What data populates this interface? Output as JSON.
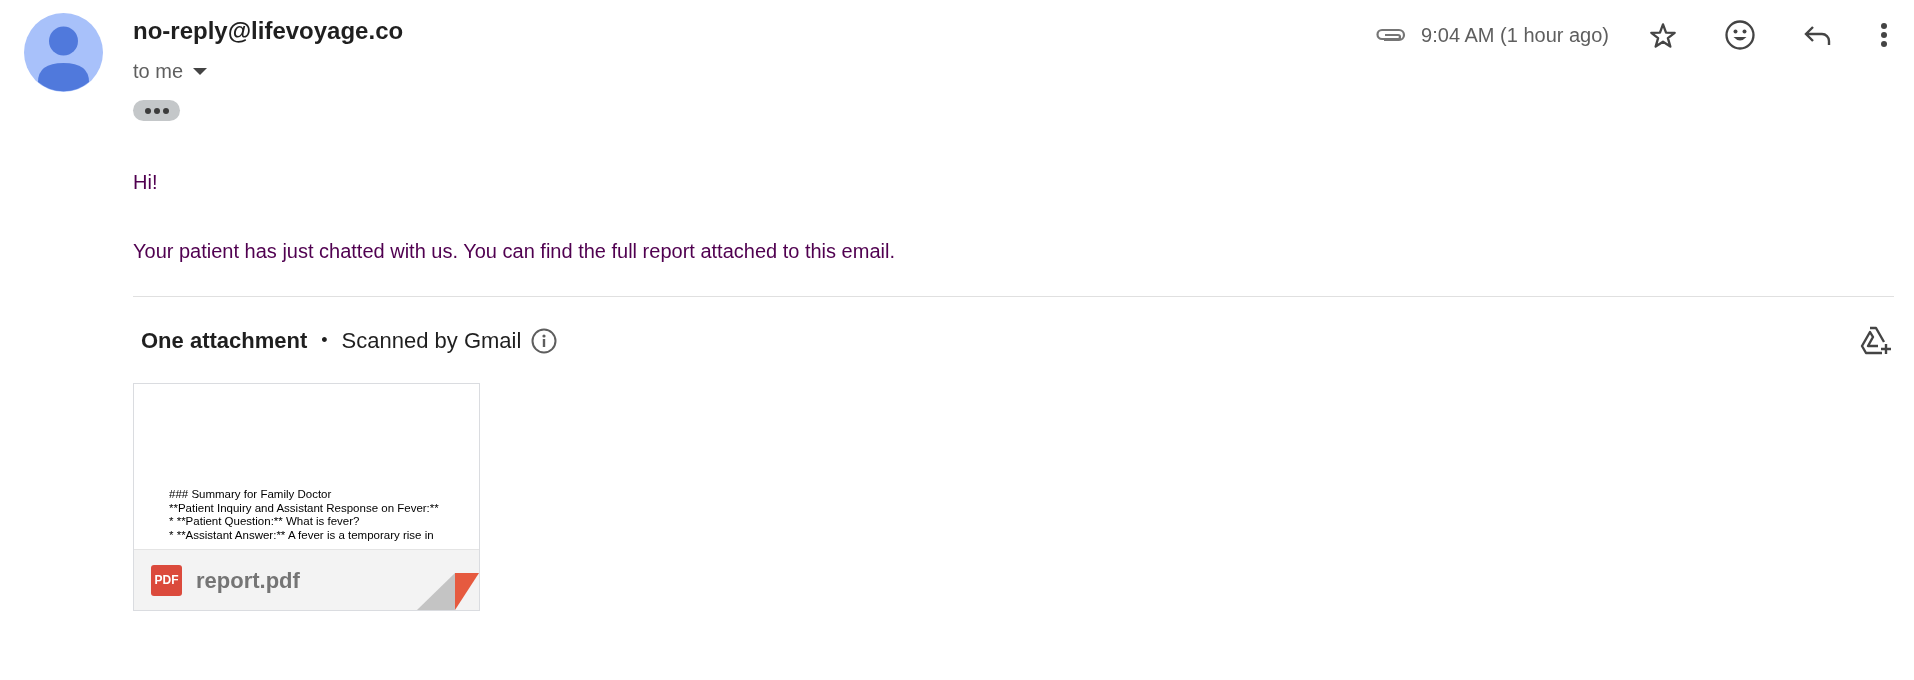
{
  "message": {
    "sender": "no-reply@lifevoyage.co",
    "recipient": "to me",
    "time": "9:04 AM (1 hour ago)",
    "has_attachment": true,
    "starred": false
  },
  "body": [
    "Hi!",
    "Your patient has just chatted with us. You can find the full report attached to this email."
  ],
  "attachments": {
    "heading": "One attachment",
    "separator": "•",
    "scan_note": "Scanned by Gmail",
    "files": [
      {
        "name": "report.pdf",
        "type_label": "PDF",
        "preview_lines": [
          "### Summary for Family Doctor",
          "**Patient Inquiry and Assistant Response on Fever:**",
          "* **Patient Question:** What is fever?",
          "* **Assistant Answer:** A fever is a temporary rise in"
        ]
      }
    ]
  }
}
